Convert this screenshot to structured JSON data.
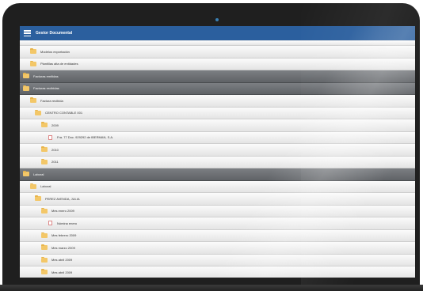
{
  "app": {
    "title": "Gestor Documental"
  },
  "rows": [
    {
      "label": "",
      "level": 1,
      "type": "folder",
      "style": "light",
      "partial": true
    },
    {
      "label": "Modelos exportación",
      "level": 1,
      "type": "folder",
      "style": "light"
    },
    {
      "label": "Plantillas alta de entidades",
      "level": 1,
      "type": "folder",
      "style": "light"
    },
    {
      "label": "Facturas emitidas",
      "level": 0,
      "type": "folder",
      "style": "dark"
    },
    {
      "label": "Facturas recibidas",
      "level": 0,
      "type": "folder",
      "style": "dark"
    },
    {
      "label": "Factura recibida",
      "level": 1,
      "type": "folder",
      "style": "light"
    },
    {
      "label": "CENTRO CONTABLE 001",
      "level": 2,
      "type": "folder",
      "style": "light"
    },
    {
      "label": "2009",
      "level": 3,
      "type": "folder",
      "style": "light"
    },
    {
      "label": "Fra. 77 Doc. 929292 de IBERMAN, S.A.",
      "level": 4,
      "type": "file",
      "style": "light"
    },
    {
      "label": "2010",
      "level": 3,
      "type": "folder",
      "style": "light"
    },
    {
      "label": "2011",
      "level": 3,
      "type": "folder",
      "style": "light"
    },
    {
      "label": "Laboral",
      "level": 0,
      "type": "folder",
      "style": "dark"
    },
    {
      "label": "Laboral",
      "level": 1,
      "type": "folder",
      "style": "light"
    },
    {
      "label": "PEREZ AVENDA, JULIA",
      "level": 2,
      "type": "folder",
      "style": "light"
    },
    {
      "label": "Mes enero 2009",
      "level": 3,
      "type": "folder",
      "style": "light"
    },
    {
      "label": "Nómina enero",
      "level": 4,
      "type": "file",
      "style": "light"
    },
    {
      "label": "Mes febrero 2009",
      "level": 3,
      "type": "folder",
      "style": "light"
    },
    {
      "label": "Mes marzo 2009",
      "level": 3,
      "type": "folder",
      "style": "light"
    },
    {
      "label": "Mes abril 2009",
      "level": 3,
      "type": "folder",
      "style": "light"
    },
    {
      "label": "Mes abril 2009",
      "level": 3,
      "type": "folder",
      "style": "light"
    }
  ]
}
